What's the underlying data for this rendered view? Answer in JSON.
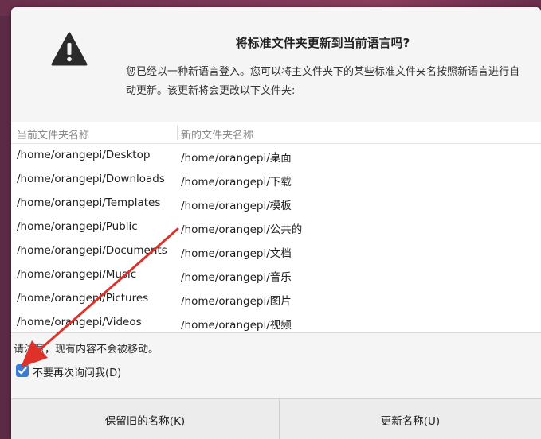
{
  "dialog": {
    "title": "将标准文件夹更新到当前语言吗?",
    "description": "您已经以一种新语言登入。您可以将主文件夹下的某些标准文件夹名按照新语言进行自动更新。该更新将会更改以下文件夹:",
    "columns": {
      "current": "当前文件夹名称",
      "new": "新的文件夹名称"
    },
    "rows": [
      {
        "current": "/home/orangepi/Desktop",
        "new": "/home/orangepi/桌面"
      },
      {
        "current": "/home/orangepi/Downloads",
        "new": "/home/orangepi/下载"
      },
      {
        "current": "/home/orangepi/Templates",
        "new": "/home/orangepi/模板"
      },
      {
        "current": "/home/orangepi/Public",
        "new": "/home/orangepi/公共的"
      },
      {
        "current": "/home/orangepi/Documents",
        "new": "/home/orangepi/文档"
      },
      {
        "current": "/home/orangepi/Music",
        "new": "/home/orangepi/音乐"
      },
      {
        "current": "/home/orangepi/Pictures",
        "new": "/home/orangepi/图片"
      },
      {
        "current": "/home/orangepi/Videos",
        "new": "/home/orangepi/视频"
      }
    ],
    "note": "请注意，现有内容不会被移动。",
    "checkbox": {
      "label": "不要再次询问我(D)",
      "checked": true
    },
    "buttons": {
      "keep": "保留旧的名称(K)",
      "update": "更新名称(U)"
    },
    "icon": "warning-icon",
    "colors": {
      "accent": "#3a7bd5",
      "arrow": "#e0302a"
    }
  }
}
